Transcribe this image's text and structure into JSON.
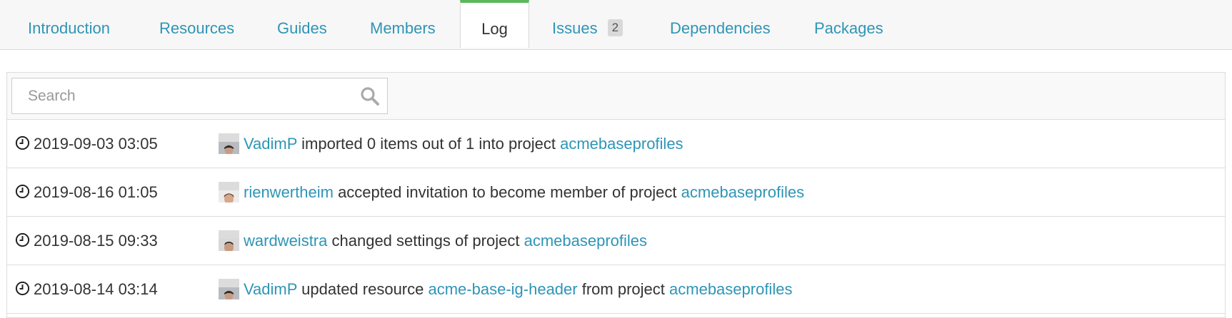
{
  "tabs": [
    {
      "label": "Introduction"
    },
    {
      "label": "Resources"
    },
    {
      "label": "Guides"
    },
    {
      "label": "Members"
    },
    {
      "label": "Log"
    },
    {
      "label": "Issues",
      "badge": "2"
    },
    {
      "label": "Dependencies"
    },
    {
      "label": "Packages"
    }
  ],
  "active_tab": "Log",
  "search": {
    "placeholder": "Search",
    "value": ""
  },
  "log": [
    {
      "time": "2019-09-03 03:05",
      "user": "VadimP",
      "text1": "imported 0 items out of 1 into project",
      "project": "acmebaseprofiles"
    },
    {
      "time": "2019-08-16 01:05",
      "user": "rienwertheim",
      "text1": "accepted invitation to become member of project",
      "project": "acmebaseprofiles"
    },
    {
      "time": "2019-08-15 09:33",
      "user": "wardweistra",
      "text1": "changed settings of project",
      "project": "acmebaseprofiles"
    },
    {
      "time": "2019-08-14 03:14",
      "user": "VadimP",
      "text1": "updated resource",
      "resource": "acme-base-ig-header",
      "text2": "from project",
      "project": "acmebaseprofiles"
    }
  ],
  "colors": {
    "link": "#2e95b6",
    "active_tab_indicator": "#5cb85c",
    "text": "#333333"
  }
}
